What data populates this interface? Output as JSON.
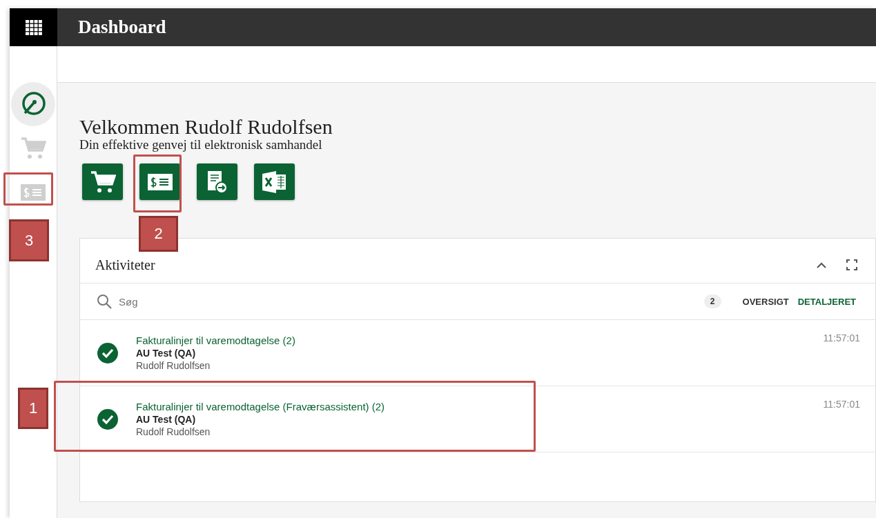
{
  "app_bar": {
    "title": "Dashboard"
  },
  "sidebar": {
    "items": [
      {
        "kind": "dashboard",
        "selected": true
      },
      {
        "kind": "cart",
        "selected": false
      },
      {
        "kind": "invoice",
        "selected": false
      }
    ]
  },
  "welcome": {
    "title": "Velkommen Rudolf Rudolfsen",
    "subtitle": "Din effektive genvej til elektronisk samhandel"
  },
  "shortcuts": [
    {
      "kind": "cart"
    },
    {
      "kind": "invoice"
    },
    {
      "kind": "document"
    },
    {
      "kind": "excel"
    }
  ],
  "activities": {
    "title": "Aktiviteter",
    "search": {
      "placeholder": "Søg"
    },
    "count": "2",
    "views": [
      {
        "label": "OVERSIGT",
        "selected": false
      },
      {
        "label": "DETALJERET",
        "selected": true
      }
    ],
    "items": [
      {
        "title": "Fakturalinjer til varemodtagelse (2)",
        "company": "AU Test (QA)",
        "user": "Rudolf Rudolfsen",
        "time": "11:57:01",
        "done": true
      },
      {
        "title": "Fakturalinjer til varemodtagelse (Fraværsassistent) (2)",
        "company": "AU Test (QA)",
        "user": "Rudolf Rudolfsen",
        "time": "11:57:01",
        "done": true
      }
    ]
  },
  "annotations": [
    {
      "label": "1"
    },
    {
      "label": "2"
    },
    {
      "label": "3"
    }
  ]
}
